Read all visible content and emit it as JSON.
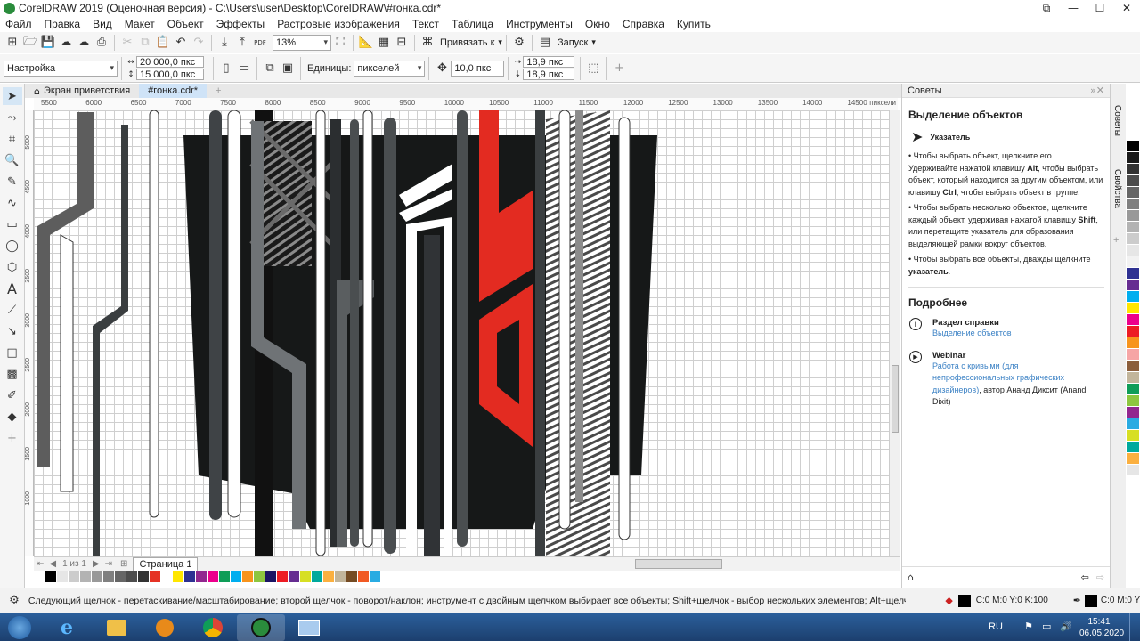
{
  "window": {
    "title": "CorelDRAW 2019 (Оценочная версия) - C:\\Users\\user\\Desktop\\CorelDRAW\\#гонка.cdr*"
  },
  "menu": [
    "Файл",
    "Правка",
    "Вид",
    "Макет",
    "Объект",
    "Эффекты",
    "Растровые изображения",
    "Текст",
    "Таблица",
    "Инструменты",
    "Окно",
    "Справка",
    "Купить"
  ],
  "toolbar": {
    "zoom": "13%",
    "snap_label": "Привязать к",
    "launch_label": "Запуск",
    "pdf_label": "PDF"
  },
  "propbar": {
    "preset": "Настройка",
    "width": "20 000,0 пкс",
    "height": "15 000,0 пкс",
    "units_label": "Единицы:",
    "units_value": "пикселей",
    "nudge": "10,0 пкс",
    "dup_x": "18,9 пкс",
    "dup_y": "18,9 пкс"
  },
  "doc_tabs": [
    "Экран приветствия",
    "#гонка.cdr*"
  ],
  "ruler": {
    "h_ticks": [
      "5500",
      "6000",
      "6500",
      "7000",
      "7500",
      "8000",
      "8500",
      "9000",
      "9500",
      "10000",
      "10500",
      "11000",
      "11500",
      "12000",
      "12500",
      "13000",
      "13500",
      "14000",
      "14500"
    ],
    "h_unit": "пиксели",
    "v_ticks": [
      "5000",
      "4500",
      "4000",
      "3500",
      "3000",
      "2500",
      "2000",
      "1500",
      "1000"
    ]
  },
  "page_nav": {
    "counter": "1 из 1",
    "page_tab": "Страница 1"
  },
  "panel": {
    "header": "Советы",
    "title": "Выделение объектов",
    "tool_name": "Указатель",
    "bullets": [
      [
        "Чтобы выбрать объект, щелкните его. Удерживайте нажатой клавишу ",
        "Alt",
        ", чтобы выбрать объект, который находится за другим объектом, или клавишу ",
        "Ctrl",
        ", чтобы выбрать объект в группе."
      ],
      [
        "Чтобы выбрать несколько объектов, щелкните каждый объект, удерживая нажатой клавишу ",
        "Shift",
        ", или перетащите указатель для образования выделяющей рамки вокруг объектов."
      ],
      [
        "Чтобы выбрать все объекты, дважды щелкните ",
        "указатель",
        "."
      ]
    ],
    "more_title": "Подробнее",
    "help_title": "Раздел справки",
    "help_link": "Выделение объектов",
    "webinar_title": "Webinar",
    "webinar_link": "Работа с кривыми (для непрофессиональных графических дизайнеров)",
    "webinar_author": ", автор Ананд Диксит (Anand Dixit)",
    "side_tabs": [
      "Советы",
      "Свойства"
    ]
  },
  "status": {
    "hint": "Следующий щелчок - перетаскивание/масштабирование; второй щелчок - поворот/наклон; инструмент с двойным щелчком выбирает все объекты; Shift+щелчок - выбор нескольких элементов; Alt+щелчок - цифры",
    "fill": "C:0 M:0 Y:0 K:100",
    "outline": "C:0 M:0 Y"
  },
  "taskbar": {
    "lang": "RU",
    "time": "15:41",
    "date": "06.05.2020"
  },
  "colors": {
    "palette": [
      "#ffffff",
      "#000000",
      "#e6e6e6",
      "#cccccc",
      "#b3b3b3",
      "#999999",
      "#808080",
      "#666666",
      "#4d4d4d",
      "#333333",
      "#e53224",
      "#ffffff",
      "#ffe600",
      "#2e3192",
      "#92278f",
      "#ec008c",
      "#0f9d58",
      "#00aeef",
      "#f7941d",
      "#8dc63f",
      "#1b1464",
      "#ed1c24",
      "#662d91",
      "#d7df23",
      "#00a99d",
      "#fbb040",
      "#c2b59b",
      "#754c24",
      "#f15a24",
      "#29abe2"
    ],
    "vpalette": [
      "#ffffff",
      "#000000",
      "#1a1a1a",
      "#333333",
      "#4d4d4d",
      "#666666",
      "#808080",
      "#999999",
      "#b3b3b3",
      "#cccccc",
      "#e6e6e6",
      "#f2f2f2",
      "#2e3192",
      "#662d91",
      "#00aeef",
      "#ffe600",
      "#ec008c",
      "#ed1c24",
      "#f7941d",
      "#f6a5a5",
      "#8b5e3c",
      "#c2b59b",
      "#0f9d58",
      "#8dc63f",
      "#92278f",
      "#29abe2",
      "#d7df23",
      "#00a99d",
      "#fbb040",
      "#e6e6e6",
      "#ffffff"
    ]
  }
}
